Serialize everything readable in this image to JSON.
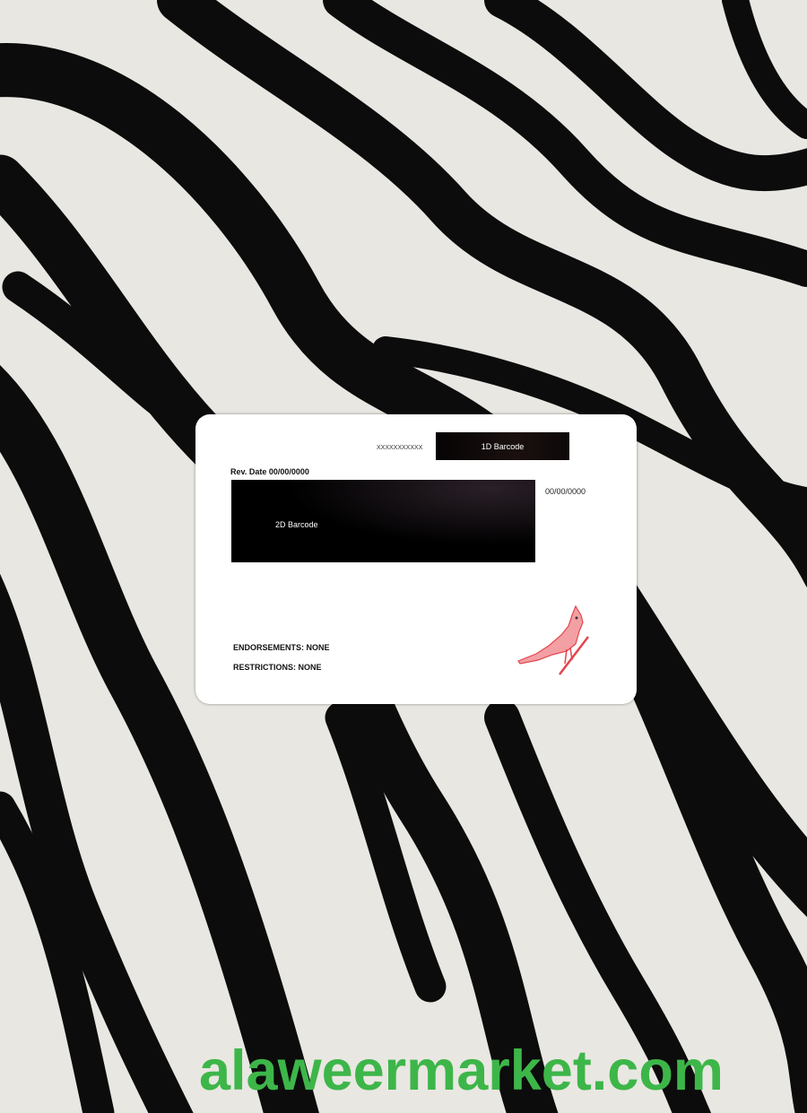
{
  "card": {
    "serial": "XXXXXXXXXXX",
    "barcode_1d_label": "1D Barcode",
    "rev_date": "Rev. Date 00/00/0000",
    "barcode_2d_label": "2D Barcode",
    "date": "00/00/0000",
    "endorsements": "ENDORSEMENTS: NONE",
    "restrictions": "RESTRICTIONS: NONE"
  },
  "watermark": "alaweermarket.com",
  "colors": {
    "watermark": "#3db649",
    "bird": "#e4454c"
  }
}
